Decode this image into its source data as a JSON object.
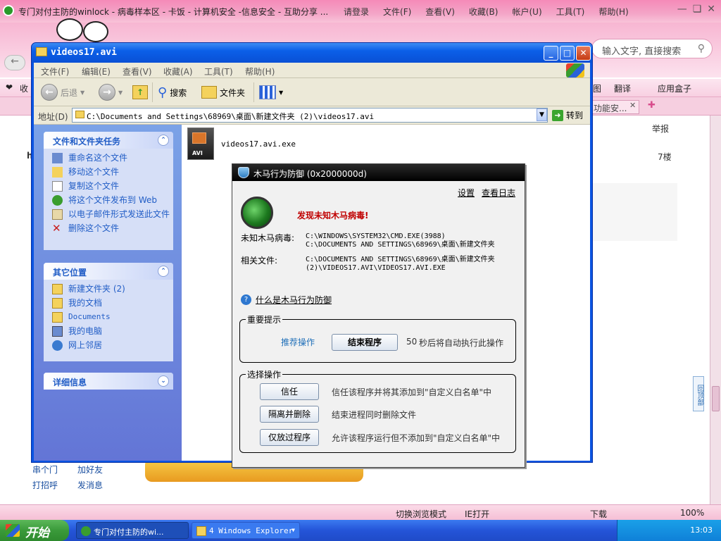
{
  "browser": {
    "title": "专门对付主防的winlock - 病毒样本区 - 卡饭 - 计算机安全 -信息安全 - 互助分享 ...",
    "menu": [
      "请登录",
      "文件(F)",
      "查看(V)",
      "收藏(B)",
      "帐户(U)",
      "工具(T)",
      "帮助(H)"
    ],
    "search_placeholder": "输入文字, 直接搜索",
    "fav_left": "收",
    "fav_right": [
      "图",
      "翻译",
      "应用盒子"
    ],
    "tab_label": "功能安...",
    "page_report": "举报",
    "page_floor": "7楼",
    "page_h": "h",
    "page_links": [
      "串个门",
      "加好友",
      "打招呼",
      "发消息"
    ],
    "back_top": "回顶部",
    "status": [
      "切换浏览模式",
      "IE打开",
      "下载",
      "100%"
    ]
  },
  "explorer": {
    "title": "videos17.avi",
    "menu": [
      "文件(F)",
      "编辑(E)",
      "查看(V)",
      "收藏(A)",
      "工具(T)",
      "帮助(H)"
    ],
    "toolbar": {
      "back": "后退",
      "search": "搜索",
      "folders": "文件夹"
    },
    "address_label": "地址(D)",
    "address": "C:\\Documents and Settings\\68969\\桌面\\新建文件夹 (2)\\videos17.avi",
    "go": "转到",
    "tasks_title": "文件和文件夹任务",
    "tasks": [
      "重命名这个文件",
      "移动这个文件",
      "复制这个文件",
      "将这个文件发布到 Web",
      "以电子邮件形式发送此文件",
      "删除这个文件"
    ],
    "places_title": "其它位置",
    "places": [
      "新建文件夹 (2)",
      "我的文档",
      "Documents",
      "我的电脑",
      "网上邻居"
    ],
    "details_title": "详细信息",
    "file_name": "videos17.avi.exe",
    "file_icon_label": "AVI"
  },
  "dialog": {
    "title": "木马行为防御 (0x2000000d)",
    "settings": "设置",
    "log": "查看日志",
    "alert": "发现未知木马病毒!",
    "virus_label": "未知木马病毒:",
    "virus_value": "C:\\WINDOWS\\SYSTEM32\\CMD.EXE(3988)\nC:\\DOCUMENTS AND SETTINGS\\68969\\桌面\\新建文件夹",
    "related_label": "相关文件:",
    "related_value": "C:\\DOCUMENTS AND SETTINGS\\68969\\桌面\\新建文件夹\n(2)\\VIDEOS17.AVI\\VIDEOS17.AVI.EXE",
    "help_link": "什么是木马行为防御",
    "important_title": "重要提示",
    "recommend": "推荐操作",
    "end_button": "结束程序",
    "countdown_num": "50",
    "countdown_text": "秒后将自动执行此操作",
    "choose_title": "选择操作",
    "actions": [
      {
        "button": "信任",
        "desc": "信任该程序并将其添加到\"自定义白名单\"中"
      },
      {
        "button": "隔离并删除",
        "desc": "结束进程同时删除文件"
      },
      {
        "button": "仅放过程序",
        "desc": "允许该程序运行但不添加到\"自定义白名单\"中"
      }
    ]
  },
  "taskbar": {
    "start": "开始",
    "items": [
      "专门对付主防的wi...",
      "4 Windows Explorer"
    ],
    "clock": "13:03"
  }
}
